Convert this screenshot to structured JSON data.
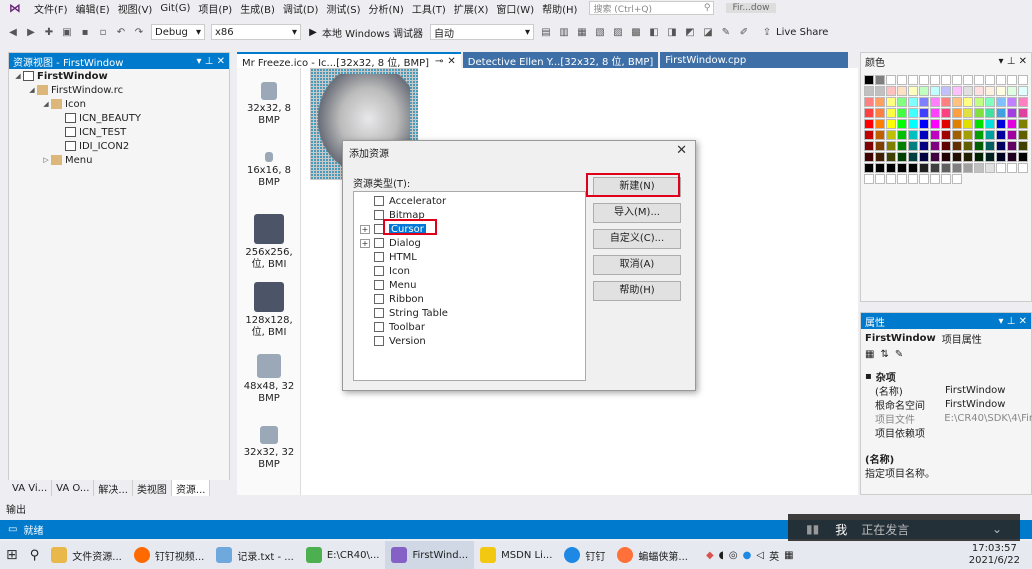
{
  "menubar": {
    "items": [
      "文件(F)",
      "编辑(E)",
      "视图(V)",
      "Git(G)",
      "项目(P)",
      "生成(B)",
      "调试(D)",
      "测试(S)",
      "分析(N)",
      "工具(T)",
      "扩展(X)",
      "窗口(W)",
      "帮助(H)"
    ],
    "search_placeholder": "搜索 (Ctrl+Q)",
    "window_title": "Fir...dow"
  },
  "toolbar": {
    "config": "Debug",
    "platform": "x86",
    "debugger": "本地 Windows 调试器",
    "auto": "自动",
    "live_share": "Live Share"
  },
  "resource_view": {
    "title": "资源视图 - FirstWindow",
    "tree": [
      "FirstWindow",
      "FirstWindow.rc",
      "Icon",
      "ICN_BEAUTY",
      "ICN_TEST",
      "IDI_ICON2",
      "Menu"
    ]
  },
  "bottom_tabs": [
    "VA Vi...",
    "VA O...",
    "解决...",
    "类视图",
    "资源..."
  ],
  "doc_tabs": [
    "Mr Freeze.ico - Ic...[32x32, 8 位, BMP]",
    "Detective Ellen Y...[32x32, 8 位, BMP]",
    "FirstWindow.cpp"
  ],
  "thumbnails": [
    {
      "line1": "32x32, 8",
      "line2": "BMP"
    },
    {
      "line1": "16x16, 8",
      "line2": "BMP"
    },
    {
      "line1": "256x256,",
      "line2": "位, BMI"
    },
    {
      "line1": "128x128,",
      "line2": "位, BMI"
    },
    {
      "line1": "48x48, 32",
      "line2": "BMP"
    },
    {
      "line1": "32x32, 32",
      "line2": "BMP"
    }
  ],
  "dialog": {
    "title": "添加资源",
    "label": "资源类型(T):",
    "types": [
      "Accelerator",
      "Bitmap",
      "Cursor",
      "Dialog",
      "HTML",
      "Icon",
      "Menu",
      "Ribbon",
      "String Table",
      "Toolbar",
      "Version"
    ],
    "buttons": {
      "new": "新建(N)",
      "import": "导入(M)...",
      "custom": "自定义(C)...",
      "cancel": "取消(A)",
      "help": "帮助(H)"
    }
  },
  "colors_panel": {
    "title": "颜色"
  },
  "properties": {
    "title": "属性",
    "object": "FirstWindow",
    "object_type": "项目属性",
    "category": "杂项",
    "rows": [
      {
        "name": "(名称)",
        "value": "FirstWindow"
      },
      {
        "name": "根命名空间",
        "value": "FirstWindow"
      },
      {
        "name": "项目文件",
        "value": "E:\\CR40\\SDK\\4\\Fir"
      },
      {
        "name": "项目依赖项",
        "value": ""
      }
    ],
    "desc_title": "(名称)",
    "desc_text": "指定项目名称。"
  },
  "output_tab": "输出",
  "status": "就绪",
  "overlay": {
    "me": "我",
    "speaking": "正在发言"
  },
  "taskbar": {
    "items": [
      "文件资源...",
      "钉钉视频...",
      "记录.txt - ...",
      "E:\\CR40\\...",
      "FirstWind...",
      "MSDN Li...",
      "钉钉",
      "蝙蝠侠第..."
    ],
    "ime": "英",
    "time": "17:03:57",
    "date": "2021/6/22"
  },
  "palette": [
    "#000000",
    "#808080",
    "#ffffff",
    "#ffffff",
    "#ffffff",
    "#ffffff",
    "#ffffff",
    "#ffffff",
    "#ffffff",
    "#ffffff",
    "#ffffff",
    "#ffffff",
    "#ffffff",
    "#ffffff",
    "#ffffff",
    "#c0c0c0",
    "#c0c0c0",
    "#ffc0c0",
    "#ffe0c0",
    "#ffffc0",
    "#c0ffc0",
    "#c0ffff",
    "#c0c0ff",
    "#ffc0ff",
    "#e0e0e0",
    "#ffe0e0",
    "#fff0e0",
    "#ffffe0",
    "#e0ffe0",
    "#e0ffff",
    "#ff8080",
    "#ffa060",
    "#ffff80",
    "#80ff80",
    "#80ffff",
    "#8080ff",
    "#ff80ff",
    "#ff8080",
    "#ffc080",
    "#ffff80",
    "#c0ff80",
    "#80ffc0",
    "#80c0ff",
    "#c080ff",
    "#ff80c0",
    "#ff4040",
    "#ff8040",
    "#ffff40",
    "#40ff40",
    "#40ffff",
    "#4040ff",
    "#ff40ff",
    "#ff4080",
    "#ffa040",
    "#e0e040",
    "#80e040",
    "#40e0a0",
    "#40a0e0",
    "#a040e0",
    "#e040a0",
    "#ff0000",
    "#ff8000",
    "#ffff00",
    "#00ff00",
    "#00ffff",
    "#0000ff",
    "#ff00ff",
    "#e00000",
    "#e08000",
    "#e0e000",
    "#00e000",
    "#00e0e0",
    "#0000e0",
    "#e000e0",
    "#808000",
    "#c00000",
    "#c06000",
    "#c0c000",
    "#00c000",
    "#00c0c0",
    "#0000c0",
    "#c000c0",
    "#a00000",
    "#a06000",
    "#a0a000",
    "#00a000",
    "#00a0a0",
    "#0000a0",
    "#a000a0",
    "#606000",
    "#800000",
    "#804000",
    "#808000",
    "#008000",
    "#008080",
    "#000080",
    "#800080",
    "#600000",
    "#603000",
    "#606000",
    "#006000",
    "#006060",
    "#000060",
    "#600060",
    "#404000",
    "#400000",
    "#402000",
    "#404000",
    "#004000",
    "#004040",
    "#000040",
    "#400040",
    "#200000",
    "#201000",
    "#202000",
    "#002000",
    "#002020",
    "#000020",
    "#200020",
    "#000000",
    "#000000",
    "#000000",
    "#000000",
    "#000000",
    "#000000",
    "#202020",
    "#404040",
    "#606060",
    "#808080",
    "#a0a0a0",
    "#c0c0c0",
    "#e0e0e0",
    "#ffffff",
    "#ffffff",
    "#ffffff",
    "#ffffff",
    "#ffffff",
    "#ffffff",
    "#ffffff",
    "#ffffff",
    "#ffffff",
    "#ffffff",
    "#ffffff",
    "#ffffff"
  ]
}
